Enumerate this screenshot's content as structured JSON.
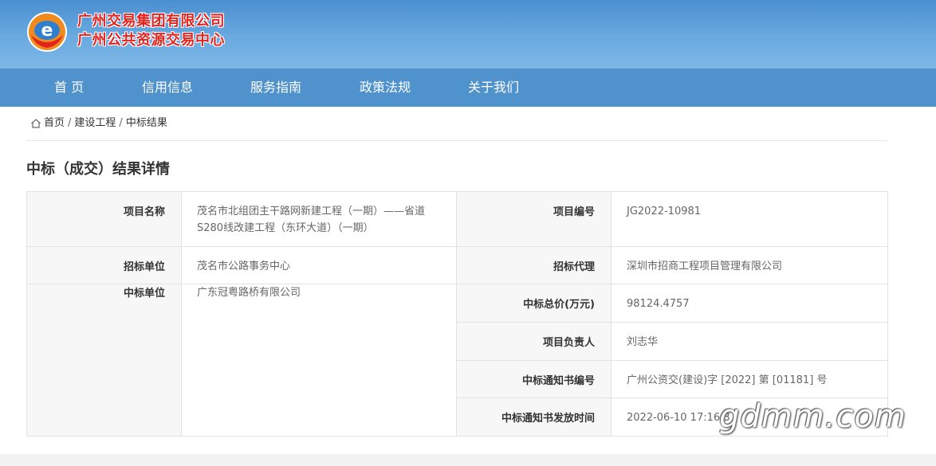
{
  "header": {
    "site_name_line1": "广州交易集团有限公司",
    "site_name_line2": "广州公共资源交易中心",
    "logo_letter": "e"
  },
  "nav": {
    "items": [
      "首 页",
      "信用信息",
      "服务指南",
      "政策法规",
      "关于我们"
    ]
  },
  "breadcrumb": {
    "items": [
      "首页",
      "建设工程",
      "中标结果"
    ],
    "separator": "/"
  },
  "page_title": "中标（成交）结果详情",
  "detail": {
    "project_name_label": "项目名称",
    "project_name_value_line1": "茂名市北组团主干路网新建工程（一期）——省道",
    "project_name_value_line2": "S280线改建工程（东环大道）（一期）",
    "project_no_label": "项目编号",
    "project_no_value": "JG2022-10981",
    "tenderer_label": "招标单位",
    "tenderer_value": "茂名市公路事务中心",
    "agent_label": "招标代理",
    "agent_value": "深圳市招商工程项目管理有限公司",
    "winner_label": "中标单位",
    "winner_value": "广东冠粤路桥有限公司",
    "total_price_label": "中标总价(万元)",
    "total_price_value": "98124.4757",
    "manager_label": "项目负责人",
    "manager_value": "刘志华",
    "notice_no_label": "中标通知书编号",
    "notice_no_value": "广州公资交(建设)字 [2022] 第 [01181] 号",
    "notice_time_label": "中标通知书发放时间",
    "notice_time_value": "2022-06-10 17:16:3"
  },
  "watermark": "gdmm.com",
  "colors": {
    "header_blue": "#4a8fd0",
    "nav_blue": "#4f92cc",
    "brand_red": "#e2241f",
    "logo_orange": "#f08a1e"
  }
}
